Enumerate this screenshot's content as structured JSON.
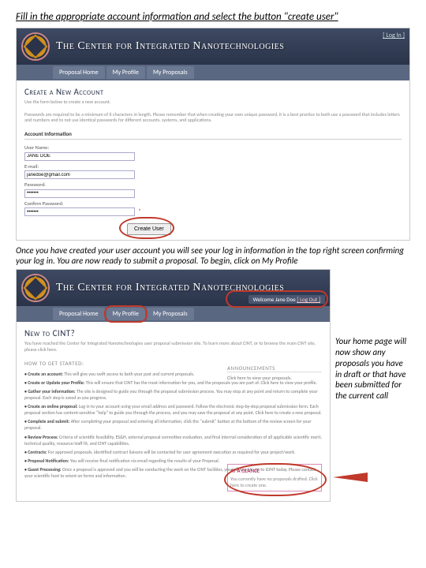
{
  "instruction1": "Fill in the appropriate account information and select the button \"create user\"",
  "instruction2": "Once you have created your user account you will see your log in information in the top right screen confirming your log in. You are now ready to submit a proposal. To begin, click on My Profile",
  "side_note": "Your home page will now show any proposals you have in draft or that have been submitted for the current call",
  "banner_title": "The Center for Integrated Nanotechnologies",
  "login_link": "[ Log In ]",
  "welcome_user": "Welcome Jane Doe",
  "logout": "[ Log Out ]",
  "nav": {
    "home": "Proposal Home",
    "profile": "My Profile",
    "proposals": "My Proposals"
  },
  "page1": {
    "title": "Create a New Account",
    "intro": "Use the form below to create a new account.",
    "pw_rule": "Passwords are required to be a minimum of 6 characters in length. Please remember that when creating your own unique password, it is a best practice to both use a password that includes letters and numbers and to not use identical passwords for different accounts, systems, and applications.",
    "section": "Account Information",
    "labels": {
      "user": "User Name:",
      "email": "E-mail:",
      "pw": "Password:",
      "cpw": "Confirm Password:"
    },
    "values": {
      "user": "JANE DOE",
      "email": "janedoe@gmail.com",
      "pw": "•••••••",
      "cpw": "•••••••"
    },
    "button": "Create User"
  },
  "page2": {
    "title": "New to CINT?",
    "intro": "You have reached the Center for Integrated Nanotechnologies user proposal submission site. To learn more about CINT, or to browse the main CINT site, please click here.",
    "how": "HOW TO GET STARTED:",
    "steps": {
      "s1": {
        "h": "Create an account:",
        "t": "This will give you swift access to both your past and current proposals."
      },
      "s2": {
        "h": "Create or Update your Profile:",
        "t": "This will ensure that CINT has the most information for you, and the proposals you are part of. Click here to view your profile."
      },
      "s3": {
        "h": "Gather your information:",
        "t": "The site is designed to guide you through the proposal submission process. You may stop at any point and return to complete your proposal. Each step is saved as you progress."
      },
      "s4": {
        "h": "Create an online proposal:",
        "t": "Log in to your account using your email address and password. Follow the electronic step-by-step proposal submission form. Each proposal section has content-sensitive \"help\" to guide you through the process, and you may save the proposal at any point. Click here to create a new proposal."
      },
      "s5": {
        "h": "Complete and submit:",
        "t": "After completing your proposal and entering all information, click the \"submit\" button at the bottom of the review screen for your proposal."
      },
      "s6": {
        "h": "Review Process:",
        "t": "Criteria of scientific feasibility, ES&H, external proposal committee evaluation, and final internal consideration of all applicable scientific merit, technical quality, resource/staff fit, and CINT capabilities."
      },
      "s7": {
        "h": "Contracts:",
        "t": "For approved proposals, identified contract liaisons will be contacted for user agreement execution as required for your project/work."
      },
      "s8": {
        "h": "Proposal Notification:",
        "t": "You will receive final notification via email regarding the results of your Proposal."
      },
      "s9": {
        "h": "Guest Processing:",
        "t": "Once a proposal is approved and you will be conducting the work on the CINT facilities, you will need to go to iCINT today. Please contact your scientific host to orient on forms and information."
      }
    },
    "ann_h": "ANNOUNCEMENTS",
    "ann_t": "Click here to view your proposals.",
    "glance_h": "AT A GLANCE",
    "glance_t": "You currently have no proposals drafted. Click here to create one."
  }
}
